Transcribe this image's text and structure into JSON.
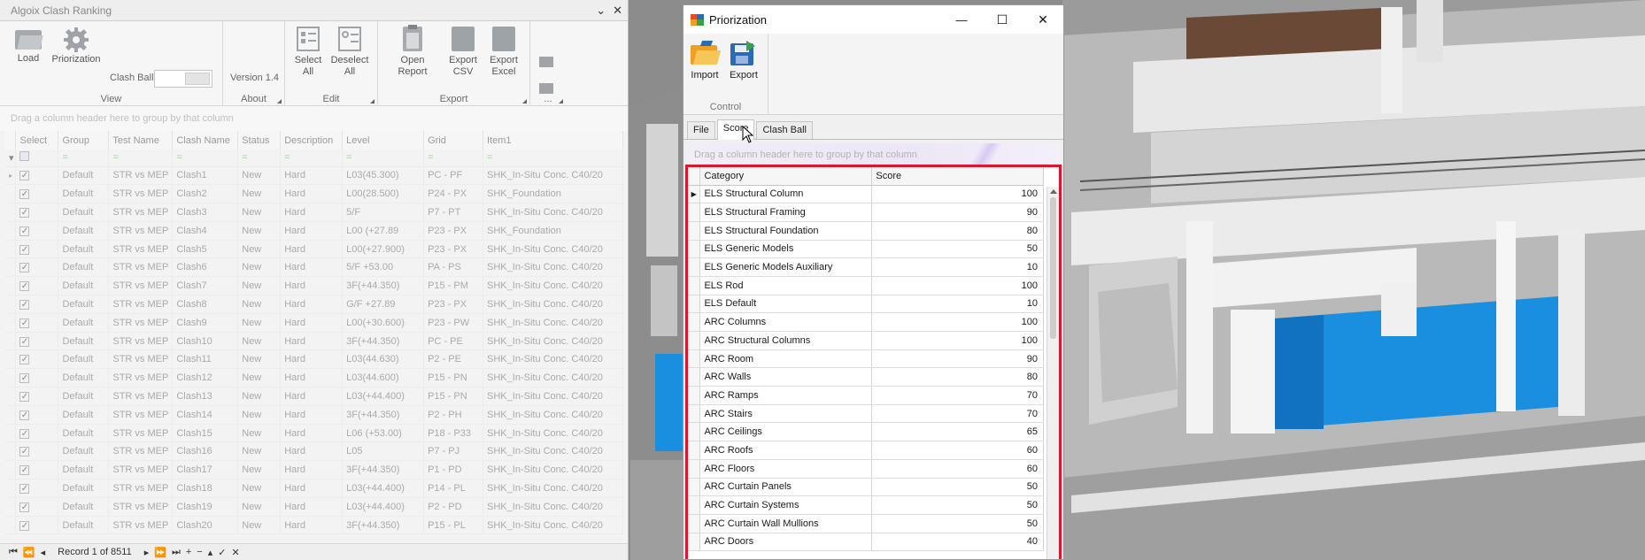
{
  "left_panel": {
    "title": "Algoix Clash Ranking",
    "window_controls": {
      "pin": "⌄",
      "close": "✕"
    },
    "ribbon": {
      "view": {
        "label": "View",
        "load": "Load",
        "priorization": "Priorization",
        "clash_ball": "Clash Ball"
      },
      "about": {
        "label": "About",
        "version": "Version 1.4"
      },
      "edit": {
        "label": "Edit",
        "select_all": "Select All",
        "deselect_all": "Deselect All"
      },
      "export": {
        "label": "Export",
        "open_report": "Open Report",
        "export_csv": "Export CSV",
        "export_excel": "Export Excel"
      },
      "more": {
        "label": "..."
      }
    },
    "groupby_hint": "Drag a column header here to group by that column",
    "columns": [
      "Select",
      "Group",
      "Test Name",
      "Clash Name",
      "Status",
      "Description",
      "Level",
      "Grid",
      "Item1"
    ],
    "filter_placeholder": "=",
    "rows": [
      [
        "Default",
        "STR vs MEP",
        "Clash1",
        "New",
        "Hard",
        "L03(45.300)",
        "PC - PF",
        "SHK_In-Situ Conc. C40/20"
      ],
      [
        "Default",
        "STR vs MEP",
        "Clash2",
        "New",
        "Hard",
        "L00(28.500)",
        "P24 - PX",
        "SHK_Foundation"
      ],
      [
        "Default",
        "STR vs MEP",
        "Clash3",
        "New",
        "Hard",
        "5/F",
        "P7 - PT",
        "SHK_In-Situ Conc. C40/20"
      ],
      [
        "Default",
        "STR vs MEP",
        "Clash4",
        "New",
        "Hard",
        "L00 (+27.89",
        "P23 - PX",
        "SHK_Foundation"
      ],
      [
        "Default",
        "STR vs MEP",
        "Clash5",
        "New",
        "Hard",
        "L00(+27.900)",
        "P23 - PX",
        "SHK_In-Situ Conc. C40/20"
      ],
      [
        "Default",
        "STR vs MEP",
        "Clash6",
        "New",
        "Hard",
        "5/F +53.00",
        "PA - PS",
        "SHK_In-Situ Conc. C40/20"
      ],
      [
        "Default",
        "STR vs MEP",
        "Clash7",
        "New",
        "Hard",
        "3F(+44.350)",
        "P15 - PM",
        "SHK_In-Situ Conc. C40/20"
      ],
      [
        "Default",
        "STR vs MEP",
        "Clash8",
        "New",
        "Hard",
        "G/F +27.89",
        "P23 - PX",
        "SHK_In-Situ Conc. C40/20"
      ],
      [
        "Default",
        "STR vs MEP",
        "Clash9",
        "New",
        "Hard",
        "L00(+30.600)",
        "P23 - PW",
        "SHK_In-Situ Conc. C40/20"
      ],
      [
        "Default",
        "STR vs MEP",
        "Clash10",
        "New",
        "Hard",
        "3F(+44.350)",
        "PC - PE",
        "SHK_In-Situ Conc. C40/20"
      ],
      [
        "Default",
        "STR vs MEP",
        "Clash11",
        "New",
        "Hard",
        "L03(44.630)",
        "P2 - PE",
        "SHK_In-Situ Conc. C40/20"
      ],
      [
        "Default",
        "STR vs MEP",
        "Clash12",
        "New",
        "Hard",
        "L03(44.600)",
        "P15 - PN",
        "SHK_In-Situ Conc. C40/20"
      ],
      [
        "Default",
        "STR vs MEP",
        "Clash13",
        "New",
        "Hard",
        "L03(+44.400)",
        "P15 - PN",
        "SHK_In-Situ Conc. C40/20"
      ],
      [
        "Default",
        "STR vs MEP",
        "Clash14",
        "New",
        "Hard",
        "3F(+44.350)",
        "P2 - PH",
        "SHK_In-Situ Conc. C40/20"
      ],
      [
        "Default",
        "STR vs MEP",
        "Clash15",
        "New",
        "Hard",
        "L06 (+53.00)",
        "P18 - P33",
        "SHK_In-Situ Conc. C40/20"
      ],
      [
        "Default",
        "STR vs MEP",
        "Clash16",
        "New",
        "Hard",
        "L05",
        "P7 - PJ",
        "SHK_In-Situ Conc. C40/20"
      ],
      [
        "Default",
        "STR vs MEP",
        "Clash17",
        "New",
        "Hard",
        "3F(+44.350)",
        "P1 - PD",
        "SHK_In-Situ Conc. C40/20"
      ],
      [
        "Default",
        "STR vs MEP",
        "Clash18",
        "New",
        "Hard",
        "L03(+44.400)",
        "P14 - PL",
        "SHK_In-Situ Conc. C40/20"
      ],
      [
        "Default",
        "STR vs MEP",
        "Clash19",
        "New",
        "Hard",
        "L03(+44.400)",
        "P2 - PD",
        "SHK_In-Situ Conc. C40/20"
      ],
      [
        "Default",
        "STR vs MEP",
        "Clash20",
        "New",
        "Hard",
        "3F(+44.350)",
        "P15 - PL",
        "SHK_In-Situ Conc. C40/20"
      ]
    ],
    "navigator": {
      "record_text": "Record 1 of 8511"
    }
  },
  "dialog": {
    "title": "Priorization",
    "controls": {
      "minimize": "—",
      "maximize": "☐",
      "close": "✕"
    },
    "ribbon": {
      "import": "Import",
      "export": "Export",
      "group_label": "Control"
    },
    "tabs": [
      "File",
      "Score",
      "Clash Ball"
    ],
    "active_tab": "Score",
    "groupby_hint": "Drag a column header here to group by that column",
    "columns": [
      "Category",
      "Score"
    ],
    "rows": [
      {
        "category": "ELS Structural Column",
        "score": "100"
      },
      {
        "category": "ELS Structural Framing",
        "score": "90"
      },
      {
        "category": "ELS Structural Foundation",
        "score": "80"
      },
      {
        "category": "ELS Generic Models",
        "score": "50"
      },
      {
        "category": "ELS Generic Models Auxiliary",
        "score": "10"
      },
      {
        "category": "ELS Rod",
        "score": "100"
      },
      {
        "category": "ELS Default",
        "score": "10"
      },
      {
        "category": "ARC Columns",
        "score": "100"
      },
      {
        "category": "ARC Structural Columns",
        "score": "100"
      },
      {
        "category": "ARC Room",
        "score": "90"
      },
      {
        "category": "ARC Walls",
        "score": "80"
      },
      {
        "category": "ARC Ramps",
        "score": "70"
      },
      {
        "category": "ARC Stairs",
        "score": "70"
      },
      {
        "category": "ARC Ceilings",
        "score": "65"
      },
      {
        "category": "ARC Roofs",
        "score": "60"
      },
      {
        "category": "ARC Floors",
        "score": "60"
      },
      {
        "category": "ARC Curtain Panels",
        "score": "50"
      },
      {
        "category": "ARC Curtain Systems",
        "score": "50"
      },
      {
        "category": "ARC Curtain Wall Mullions",
        "score": "50"
      },
      {
        "category": "ARC Doors",
        "score": "40"
      }
    ]
  },
  "colors": {
    "highlight": "#e0152d",
    "model_blue": "#1a8fe0",
    "icon_orange": "#f0a020",
    "icon_blue": "#2a6bb8"
  }
}
